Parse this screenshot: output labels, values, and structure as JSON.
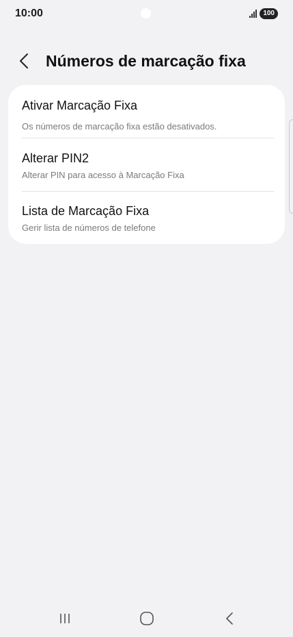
{
  "status_bar": {
    "time": "10:00",
    "battery": "100"
  },
  "header": {
    "title": "Números de marcação fixa",
    "back_icon": "chevron-left-icon"
  },
  "settings": {
    "items": [
      {
        "title": "Ativar Marcação Fixa",
        "subtitle": "Os números de marcação fixa estão desativados."
      },
      {
        "title": "Alterar PIN2",
        "subtitle": "Alterar PIN para acesso à Marcação Fixa"
      },
      {
        "title": "Lista de Marcação Fixa",
        "subtitle": "Gerir lista de números de telefone"
      }
    ]
  },
  "nav_bar": {
    "icons": [
      "recent-apps-icon",
      "home-icon",
      "back-icon"
    ]
  },
  "colors": {
    "background": "#f2f2f4",
    "card": "#ffffff",
    "subtitle": "#7a7a7a"
  }
}
